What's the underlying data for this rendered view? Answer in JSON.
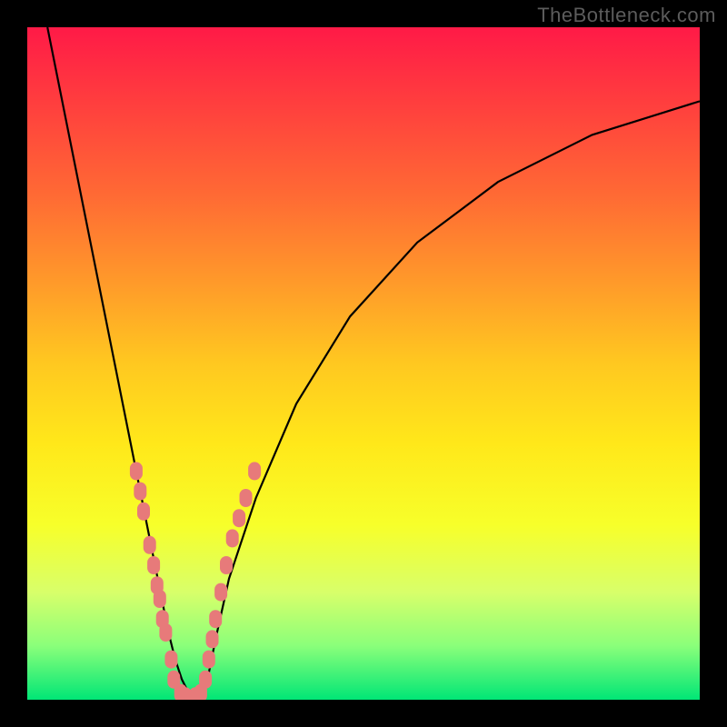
{
  "watermark": {
    "text": "TheBottleneck.com"
  },
  "chart_data": {
    "type": "line",
    "title": "",
    "xlabel": "",
    "ylabel": "",
    "xlim": [
      0,
      100
    ],
    "ylim": [
      0,
      100
    ],
    "grid": false,
    "legend": false,
    "series": [
      {
        "name": "bottleneck-curve",
        "color": "#000000",
        "x": [
          3,
          5,
          7,
          9,
          11,
          13,
          15,
          17,
          18,
          19,
          20,
          21,
          22,
          23,
          24,
          25,
          26,
          27,
          28,
          30,
          34,
          40,
          48,
          58,
          70,
          84,
          100
        ],
        "y": [
          100,
          90,
          80,
          70,
          60,
          50,
          40,
          30,
          25,
          20,
          15,
          10,
          6,
          3,
          1,
          0,
          1,
          4,
          9,
          18,
          30,
          44,
          57,
          68,
          77,
          84,
          89
        ]
      }
    ],
    "markers": [
      {
        "name": "left-branch-points",
        "color": "#e77a7a",
        "shape": "rounded-rect",
        "x": [
          16.2,
          16.8,
          17.3,
          18.2,
          18.8,
          19.3,
          19.7,
          20.1,
          20.6,
          21.4,
          21.8
        ],
        "y": [
          34,
          31,
          28,
          23,
          20,
          17,
          15,
          12,
          10,
          6,
          3
        ]
      },
      {
        "name": "right-branch-points",
        "color": "#e77a7a",
        "shape": "rounded-rect",
        "x": [
          26.5,
          27.0,
          27.5,
          28.0,
          28.8,
          29.6,
          30.5,
          31.5,
          32.5,
          33.8
        ],
        "y": [
          3,
          6,
          9,
          12,
          16,
          20,
          24,
          27,
          30,
          34
        ]
      },
      {
        "name": "bottom-points",
        "color": "#e77a7a",
        "shape": "rounded-rect",
        "x": [
          22.8,
          23.5,
          24.2,
          25.0,
          25.8
        ],
        "y": [
          1,
          0.5,
          0,
          0.5,
          1
        ]
      }
    ],
    "background_gradient": {
      "top": "#ff1a47",
      "bottom": "#00e676"
    }
  }
}
